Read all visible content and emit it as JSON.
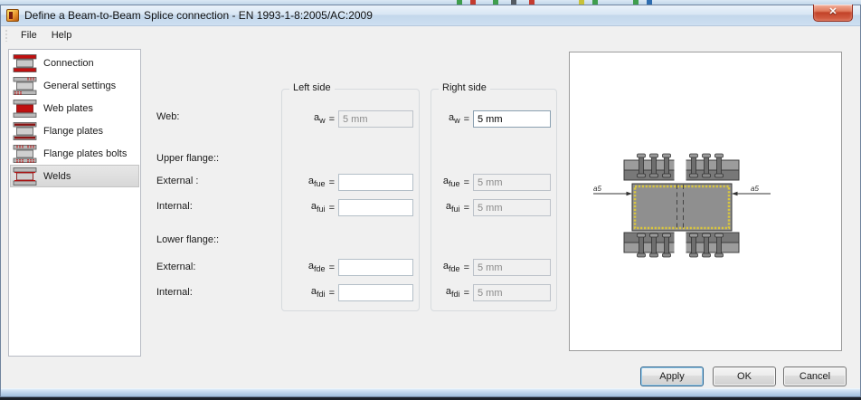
{
  "window": {
    "title": "Define a Beam-to-Beam Splice connection - EN 1993-1-8:2005/AC:2009"
  },
  "icons": {
    "close": "✕"
  },
  "colors": {
    "weld_yellow": "#d9c63e",
    "icon_red": "#c01010",
    "titlebar_blue": "#cddff1",
    "dialog_bg": "#f0f0f0"
  },
  "menu": {
    "items": [
      {
        "label": "File"
      },
      {
        "label": "Help"
      }
    ]
  },
  "sidebar": {
    "selected_index": 5,
    "items": [
      {
        "label": "Connection",
        "icon": "connection-icon"
      },
      {
        "label": "General settings",
        "icon": "general-settings-icon"
      },
      {
        "label": "Web plates",
        "icon": "web-plates-icon"
      },
      {
        "label": "Flange plates",
        "icon": "flange-plates-icon"
      },
      {
        "label": "Flange plates bolts",
        "icon": "flange-plates-bolts-icon"
      },
      {
        "label": "Welds",
        "icon": "welds-icon"
      }
    ]
  },
  "form": {
    "row_labels": [
      {
        "text": "Web:"
      },
      {
        "text": "Upper flange::"
      },
      {
        "text": "External :"
      },
      {
        "text": "Internal:"
      },
      {
        "text": "Lower flange::"
      },
      {
        "text": "External:"
      },
      {
        "text": "Internal:"
      }
    ],
    "groups": [
      {
        "title": "Left side",
        "fields": [
          {
            "sym": "a",
            "sub": "w",
            "eq": "=",
            "value": "5 mm",
            "state": "disabled"
          },
          {
            "sym": "a",
            "sub": "fue",
            "eq": "=",
            "value": "",
            "state": "enabled"
          },
          {
            "sym": "a",
            "sub": "fui",
            "eq": "=",
            "value": "",
            "state": "enabled"
          },
          {
            "sym": "a",
            "sub": "fde",
            "eq": "=",
            "value": "",
            "state": "enabled"
          },
          {
            "sym": "a",
            "sub": "fdi",
            "eq": "=",
            "value": "",
            "state": "enabled"
          }
        ]
      },
      {
        "title": "Right side",
        "fields": [
          {
            "sym": "a",
            "sub": "w",
            "eq": "=",
            "value": "5 mm",
            "state": "enabled"
          },
          {
            "sym": "a",
            "sub": "fue",
            "eq": "=",
            "value": "5 mm",
            "state": "disabled"
          },
          {
            "sym": "a",
            "sub": "fui",
            "eq": "=",
            "value": "5 mm",
            "state": "disabled"
          },
          {
            "sym": "a",
            "sub": "fde",
            "eq": "=",
            "value": "5 mm",
            "state": "disabled"
          },
          {
            "sym": "a",
            "sub": "fdi",
            "eq": "=",
            "value": "5 mm",
            "state": "disabled"
          }
        ]
      }
    ]
  },
  "preview": {
    "annotation_left": "a5",
    "annotation_right": "a5"
  },
  "buttons": [
    {
      "label": "Apply",
      "default": true
    },
    {
      "label": "OK",
      "default": false
    },
    {
      "label": "Cancel",
      "default": false
    }
  ]
}
